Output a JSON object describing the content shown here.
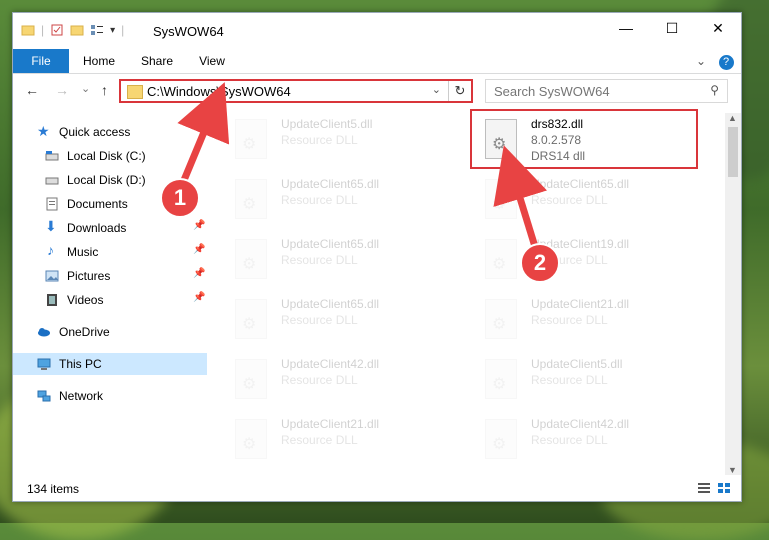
{
  "window": {
    "title": "SysWOW64"
  },
  "controls": {
    "minimize": "—",
    "maximize": "☐",
    "close": "✕",
    "help": "?"
  },
  "ribbon": {
    "tabs": [
      "File",
      "Home",
      "Share",
      "View"
    ],
    "expand": "⌄"
  },
  "nav": {
    "back": "←",
    "forward": "→",
    "recent": "⌄",
    "up": "↑"
  },
  "address": {
    "path": "C:\\Windows\\SysWOW64",
    "dropdown": "⌄",
    "refresh": "↻"
  },
  "search": {
    "placeholder": "Search SysWOW64",
    "icon": "⚲"
  },
  "sidebar": {
    "items": [
      {
        "label": "Quick access",
        "icon": "star-icon"
      },
      {
        "label": "Local Disk (C:)",
        "icon": "drive-icon"
      },
      {
        "label": "Local Disk (D:)",
        "icon": "drive-icon"
      },
      {
        "label": "Documents",
        "icon": "documents-icon"
      },
      {
        "label": "Downloads",
        "icon": "download-icon"
      },
      {
        "label": "Music",
        "icon": "music-icon"
      },
      {
        "label": "Pictures",
        "icon": "pictures-icon"
      },
      {
        "label": "Videos",
        "icon": "videos-icon"
      },
      {
        "label": "OneDrive",
        "icon": "cloud-icon"
      },
      {
        "label": "This PC",
        "icon": "computer-icon"
      },
      {
        "label": "Network",
        "icon": "network-icon"
      }
    ],
    "pin": "📌"
  },
  "files": {
    "left": [
      {
        "name": "UpdateClient5.dll",
        "type": "Resource DLL"
      },
      {
        "name": "UpdateClient65.dll",
        "type": "Resource DLL"
      },
      {
        "name": "UpdateClient65.dll",
        "type": "Resource DLL"
      },
      {
        "name": "UpdateClient65.dll",
        "type": "Resource DLL"
      },
      {
        "name": "UpdateClient42.dll",
        "type": "Resource DLL"
      },
      {
        "name": "UpdateClient21.dll",
        "type": "Resource DLL"
      }
    ],
    "right": [
      {
        "name": "drs832.dll",
        "version": "8.0.2.578",
        "type": "DRS14 dll"
      },
      {
        "name": "UpdateClient65.dll",
        "type": "Resource DLL"
      },
      {
        "name": "UpdateClient19.dll",
        "type": "Resource DLL"
      },
      {
        "name": "UpdateClient21.dll",
        "type": "Resource DLL"
      },
      {
        "name": "UpdateClient5.dll",
        "type": "Resource DLL"
      },
      {
        "name": "UpdateClient42.dll",
        "type": "Resource DLL"
      }
    ]
  },
  "status": {
    "count": "134 items"
  },
  "callouts": {
    "one": "1",
    "two": "2"
  },
  "colors": {
    "accent": "#1979ca",
    "highlight": "#d9353a",
    "callout": "#e84343"
  }
}
